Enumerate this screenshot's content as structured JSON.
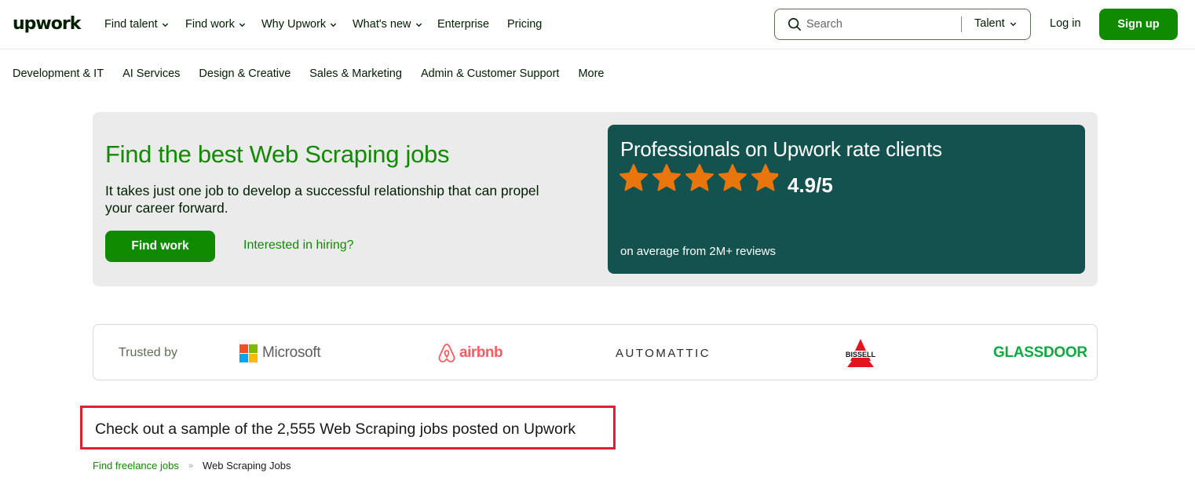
{
  "header": {
    "logo_text": "upwork",
    "nav": [
      "Find talent",
      "Find work",
      "Why Upwork",
      "What's new",
      "Enterprise",
      "Pricing"
    ],
    "search": {
      "placeholder": "Search",
      "scope": "Talent"
    },
    "login": "Log in",
    "signup": "Sign up"
  },
  "categories": [
    "Development & IT",
    "AI Services",
    "Design & Creative",
    "Sales & Marketing",
    "Admin & Customer Support",
    "More"
  ],
  "hero": {
    "title": "Find the best Web Scraping jobs",
    "subtitle": "It takes just one job to develop a successful relationship that can propel your career forward.",
    "primary_button": "Find work",
    "secondary_link": "Interested in hiring?",
    "rating_card": {
      "title": "Professionals on Upwork rate clients",
      "rating": "4.9/5",
      "stars": 4.9,
      "note": "on average from 2M+ reviews",
      "star_color": "#e8760c",
      "bg_color": "#14524f"
    }
  },
  "trusted": {
    "label": "Trusted by",
    "brands": [
      "Microsoft",
      "airbnb",
      "AUTOMATTIC",
      "BISSELL",
      "GLASSDOOR"
    ]
  },
  "sample_heading": "Check out a sample of the 2,555 Web Scraping jobs posted on Upwork",
  "breadcrumb": {
    "link": "Find freelance jobs",
    "separator": "»",
    "current": "Web Scraping Jobs"
  },
  "colors": {
    "brand_green": "#108a00",
    "highlight_red": "#e0202f"
  }
}
